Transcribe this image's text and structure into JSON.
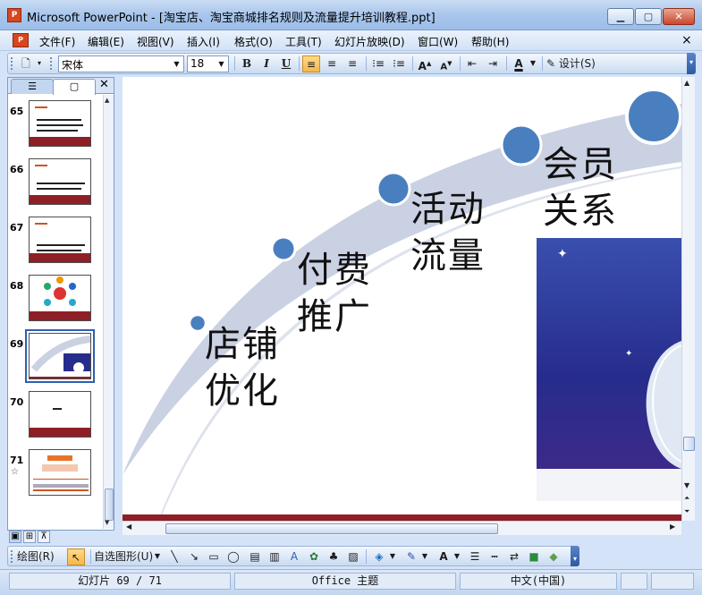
{
  "window": {
    "app_icon": "P",
    "title": "Microsoft PowerPoint - [淘宝店、淘宝商城排名规则及流量提升培训教程.ppt]",
    "min_glyph": "▁",
    "max_glyph": "▢",
    "close_glyph": "✕"
  },
  "menu": {
    "items": [
      "文件(F)",
      "编辑(E)",
      "视图(V)",
      "插入(I)",
      "格式(O)",
      "工具(T)",
      "幻灯片放映(D)",
      "窗口(W)",
      "帮助(H)"
    ],
    "close_glyph": "×"
  },
  "toolbar": {
    "font_name": "宋体",
    "font_size": "18",
    "bold": "B",
    "italic": "I",
    "underline": "U",
    "font_color_label": "A",
    "design_label": "设计(S)"
  },
  "left_panel": {
    "outline_tab_glyph": "☰",
    "slides_tab_glyph": "▢",
    "close_glyph": "✕",
    "slides": [
      {
        "num": "65",
        "star": ""
      },
      {
        "num": "66",
        "star": ""
      },
      {
        "num": "67",
        "star": ""
      },
      {
        "num": "68",
        "star": ""
      },
      {
        "num": "69",
        "star": ""
      },
      {
        "num": "70",
        "star": ""
      },
      {
        "num": "71",
        "star": "☆"
      }
    ],
    "selected_slide": "69"
  },
  "slide": {
    "labels": [
      "店铺\n优化",
      "付费\n推广",
      "活动\n流量",
      "会员\n关系"
    ],
    "colors": {
      "arc": "#c9d1e3",
      "node": "#4a7fbf",
      "panel": "#262c8c",
      "band": "#8e1f27"
    }
  },
  "drawing_toolbar": {
    "draw_label": "绘图(R)",
    "autoshapes_label": "自选图形(U)"
  },
  "status": {
    "slide_position": "幻灯片 69 / 71",
    "theme": "Office 主题",
    "language": "中文(中国)"
  }
}
